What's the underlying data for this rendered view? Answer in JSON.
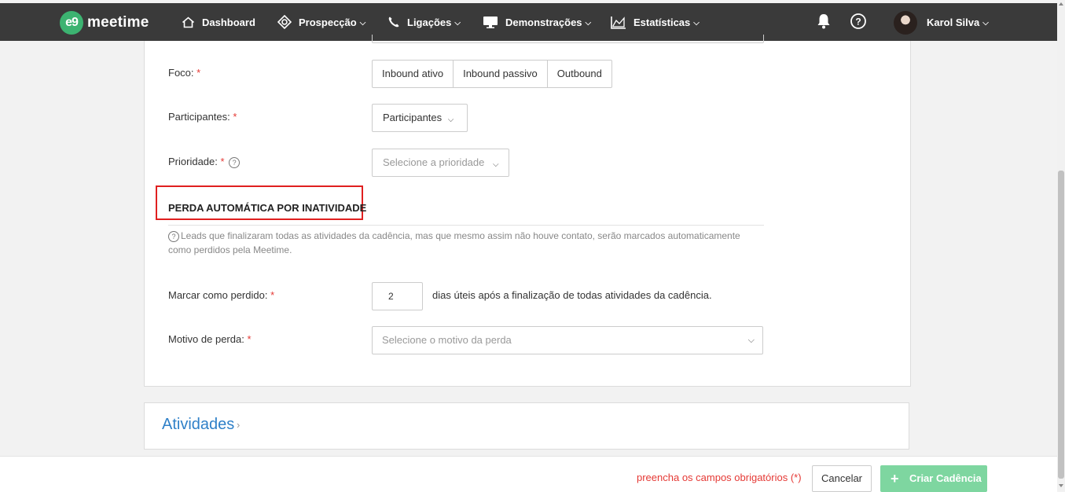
{
  "nav": {
    "logo_mark": "e9",
    "logo_text": "meetime",
    "items": [
      {
        "label": "Dashboard",
        "icon": "home-icon",
        "has_dropdown": false
      },
      {
        "label": "Prospecção",
        "icon": "target-icon",
        "has_dropdown": true
      },
      {
        "label": "Ligações",
        "icon": "phone-icon",
        "has_dropdown": true
      },
      {
        "label": "Demonstrações",
        "icon": "monitor-icon",
        "has_dropdown": true
      },
      {
        "label": "Estatísticas",
        "icon": "chart-icon",
        "has_dropdown": true
      }
    ],
    "user_name": "Karol Silva",
    "bell_icon": "bell-icon",
    "help_icon": "help-icon"
  },
  "form": {
    "foco_label": "Foco:",
    "foco_options": [
      "Inbound ativo",
      "Inbound passivo",
      "Outbound"
    ],
    "participantes_label": "Participantes:",
    "participantes_button": "Participantes",
    "prioridade_label": "Prioridade:",
    "prioridade_placeholder": "Selecione a prioridade",
    "required_mark": "*",
    "section_title": "PERDA AUTOMÁTICA POR INATIVIDADE",
    "section_help": "Leads que finalizaram todas as atividades da cadência, mas que mesmo assim não houve contato, serão marcados automaticamente como perdidos pela Meetime.",
    "marcar_label": "Marcar como perdido:",
    "marcar_value": "2",
    "marcar_suffix": "dias úteis após a finalização de todas atividades da cadência.",
    "motivo_label": "Motivo de perda:",
    "motivo_placeholder": "Selecione o motivo da perda"
  },
  "activities": {
    "title": "Atividades"
  },
  "footer": {
    "warning": "preencha os campos obrigatórios (*)",
    "cancel_label": "Cancelar",
    "create_label": "Criar Cadência"
  },
  "colors": {
    "topbar": "#3a3a3a",
    "brand_green": "#3cb371",
    "required_red": "#e53935",
    "link_blue": "#2f80c8",
    "create_button": "#7ed6a0",
    "highlight_box": "#e02020"
  }
}
